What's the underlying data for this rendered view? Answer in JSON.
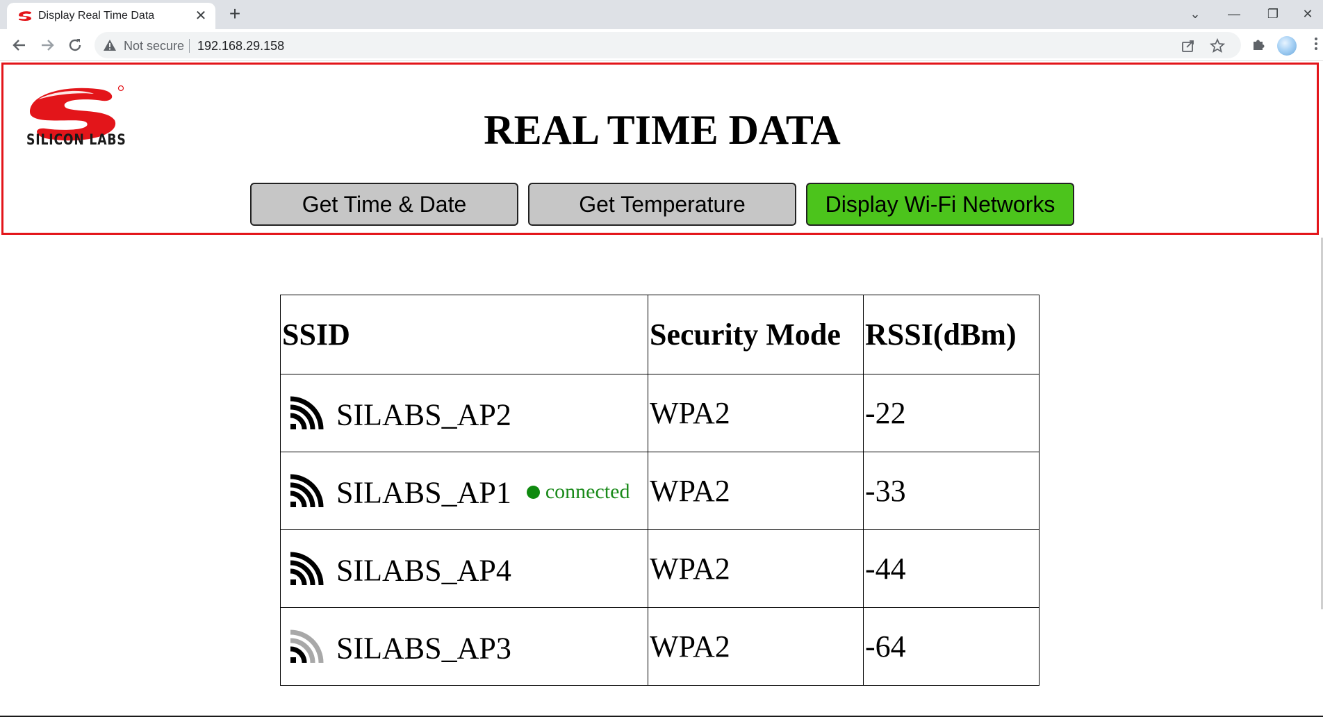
{
  "browser": {
    "tab_title": "Display Real Time Data",
    "tab_close": "✕",
    "new_tab": "+",
    "window_controls": {
      "collapse": "⌄",
      "minimize": "—",
      "restore": "❐",
      "close": "✕"
    },
    "security_label": "Not secure",
    "url": "192.168.29.158",
    "icons": [
      "back-icon",
      "forward-icon",
      "reload-icon",
      "warning-icon",
      "share-icon",
      "star-icon",
      "extensions-icon",
      "profile-avatar",
      "menu-icon"
    ]
  },
  "header": {
    "logo_text": "SILICON LABS",
    "title": "REAL TIME DATA",
    "buttons": {
      "time_date": "Get Time & Date",
      "temperature": "Get Temperature",
      "wifi": "Display Wi-Fi Networks"
    },
    "accent_border": "#e3151a",
    "active_button_color": "#4cc41c"
  },
  "table": {
    "headers": [
      "SSID",
      "Security Mode",
      "RSSI(dBm)"
    ],
    "rows": [
      {
        "ssid": "SILABS_AP2",
        "security": "WPA2",
        "rssi": "-22",
        "signal": "strong",
        "status": ""
      },
      {
        "ssid": "SILABS_AP1",
        "security": "WPA2",
        "rssi": "-33",
        "signal": "strong",
        "status": "connected"
      },
      {
        "ssid": "SILABS_AP4",
        "security": "WPA2",
        "rssi": "-44",
        "signal": "strong",
        "status": ""
      },
      {
        "ssid": "SILABS_AP3",
        "security": "WPA2",
        "rssi": "-64",
        "signal": "weak",
        "status": ""
      }
    ]
  }
}
